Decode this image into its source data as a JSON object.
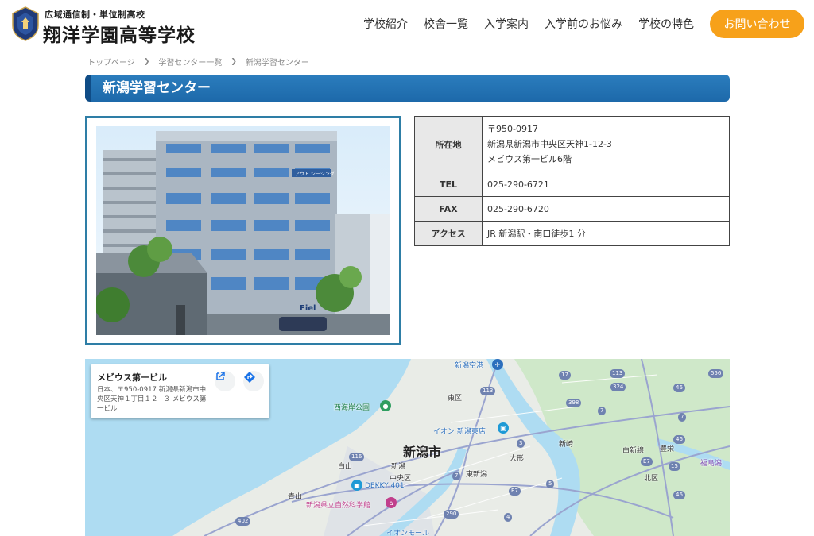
{
  "header": {
    "logo_sub": "広域通信制・単位制高校",
    "logo_main": "翔洋学園高等学校",
    "nav": [
      "学校紹介",
      "校舎一覧",
      "入学案内",
      "入学前のお悩み",
      "学校の特色"
    ],
    "cta": "お問い合わせ"
  },
  "breadcrumb": [
    "トップページ",
    "学習センター一覧",
    "新潟学習センター"
  ],
  "title": "新潟学習センター",
  "info": {
    "address_label": "所在地",
    "address_lines": [
      "〒950-0917",
      "新潟県新潟市中央区天神1-12-3",
      "メビウス第一ビル6階"
    ],
    "tel_label": "TEL",
    "tel": "025-290-6721",
    "fax_label": "FAX",
    "fax": "025-290-6720",
    "access_label": "アクセス",
    "access": "JR 新潟駅・南口徒歩1 分"
  },
  "photo": {
    "sign_text": "アウト シーシング",
    "store_text": "Fiel"
  },
  "map": {
    "card_title": "メビウス第一ビル",
    "card_address": "日本、〒950-0917 新潟県新潟市中央区天神１丁目１２−３ メビウス第一ビル",
    "labels": {
      "airport": "新潟空港",
      "nishikaigan": "西海岸公園",
      "higashi_ku": "東区",
      "aeon_higashi": "イオン 新潟東店",
      "niigata_city": "新潟市",
      "hakusan": "白山",
      "niigata_st": "新潟",
      "chuo_ku": "中央区",
      "higashi_niigata": "東新潟",
      "ogata": "大形",
      "niizaki": "新崎",
      "shirashin": "白新線",
      "toyosaka": "豊栄",
      "fukushimagata": "福島潟",
      "kita_ku": "北区",
      "aoyama": "青山",
      "dekky": "DEKKY 401",
      "science_museum": "新潟県立自然科学館",
      "aeon_mall": "イオンモール"
    },
    "route_numbers": [
      "17",
      "113",
      "556",
      "324",
      "46",
      "113",
      "398",
      "7",
      "7",
      "3",
      "116",
      "7",
      "46",
      "E7",
      "15",
      "5",
      "402",
      "290",
      "E7",
      "4",
      "46"
    ]
  }
}
